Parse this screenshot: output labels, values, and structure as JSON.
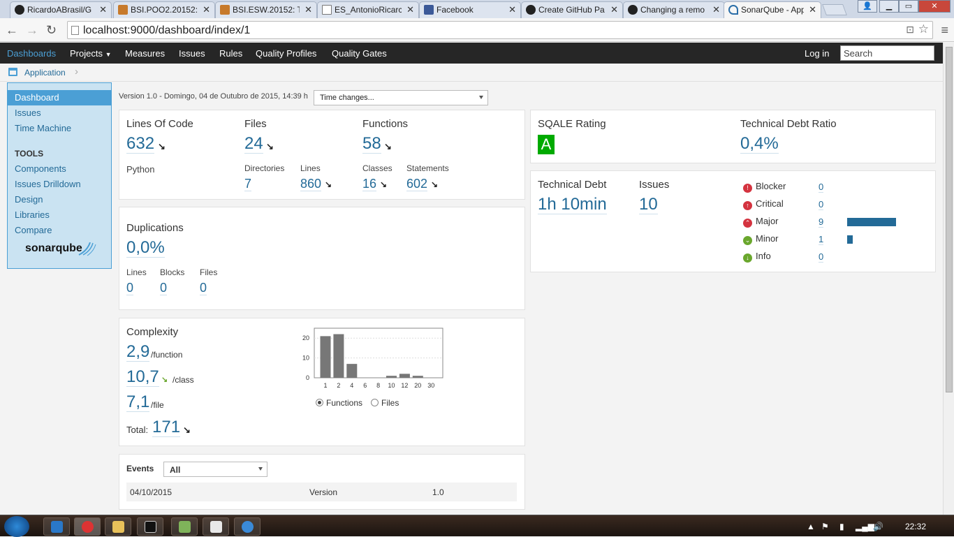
{
  "browser": {
    "tabs": [
      {
        "label": "RicardoABrasil/G",
        "icon": "github-icon"
      },
      {
        "label": "BSI.POO2.20152:",
        "icon": "moodle-icon"
      },
      {
        "label": "BSI.ESW.20152: T",
        "icon": "moodle-icon"
      },
      {
        "label": "ES_AntonioRicarc",
        "icon": "document-icon"
      },
      {
        "label": "Facebook",
        "icon": "facebook-icon"
      },
      {
        "label": "Create GitHub Pa",
        "icon": "github-icon"
      },
      {
        "label": "Changing a remo",
        "icon": "github-icon"
      },
      {
        "label": "SonarQube - App",
        "icon": "sonarqube-icon"
      }
    ],
    "url": "localhost:9000/dashboard/index/1"
  },
  "nav": {
    "dashboards": "Dashboards",
    "projects": "Projects",
    "measures": "Measures",
    "issues": "Issues",
    "rules": "Rules",
    "quality_profiles": "Quality Profiles",
    "quality_gates": "Quality Gates",
    "login": "Log in",
    "search_placeholder": "Search"
  },
  "breadcrumb": {
    "label": "Application"
  },
  "sidebar": {
    "dashboard": "Dashboard",
    "issues": "Issues",
    "time_machine": "Time Machine",
    "tools_heading": "TOOLS",
    "components": "Components",
    "issues_drilldown": "Issues Drilldown",
    "design": "Design",
    "libraries": "Libraries",
    "compare": "Compare",
    "logo": "sonarqube"
  },
  "header": {
    "version": "Version 1.0 - Domingo, 04 de Outubro de 2015, 14:39 h",
    "time_changes": "Time changes..."
  },
  "size": {
    "loc_label": "Lines Of Code",
    "loc": "632",
    "files_label": "Files",
    "files": "24",
    "functions_label": "Functions",
    "functions": "58",
    "language": "Python",
    "directories_label": "Directories",
    "directories": "7",
    "lines_label": "Lines",
    "lines": "860",
    "classes_label": "Classes",
    "classes": "16",
    "statements_label": "Statements",
    "statements": "602"
  },
  "duplications": {
    "title": "Duplications",
    "density": "0,0%",
    "lines_label": "Lines",
    "lines": "0",
    "blocks_label": "Blocks",
    "blocks": "0",
    "files_label": "Files",
    "files": "0"
  },
  "complexity": {
    "title": "Complexity",
    "per_function": "2,9",
    "per_function_unit": "/function",
    "per_class": "10,7",
    "per_class_unit": "/class",
    "per_file": "7,1",
    "per_file_unit": "/file",
    "total_label": "Total:",
    "total": "171",
    "radio_functions": "Functions",
    "radio_files": "Files"
  },
  "chart_data": {
    "type": "bar",
    "categories": [
      "1",
      "2",
      "4",
      "6",
      "8",
      "10",
      "12",
      "20",
      "30"
    ],
    "values": [
      21,
      22,
      7,
      0,
      0,
      1,
      2,
      1,
      0
    ],
    "yticks": [
      "0",
      "10",
      "20"
    ],
    "ylim": [
      0,
      25
    ],
    "title": "",
    "xlabel": "",
    "ylabel": "",
    "grid": true
  },
  "events": {
    "title": "Events",
    "filter": "All",
    "rows": [
      {
        "date": "04/10/2015",
        "type": "Version",
        "name": "1.0"
      }
    ]
  },
  "sqale": {
    "rating_label": "SQALE Rating",
    "rating": "A",
    "ratio_label": "Technical Debt Ratio",
    "ratio": "0,4%"
  },
  "issues": {
    "debt_label": "Technical Debt",
    "debt": "1h 10min",
    "issues_label": "Issues",
    "issues": "10",
    "severities": [
      {
        "name": "Blocker",
        "count": "0",
        "fraction": 0,
        "color": "#d4333f",
        "icon": "blocker-icon"
      },
      {
        "name": "Critical",
        "count": "0",
        "fraction": 0,
        "color": "#d4333f",
        "icon": "critical-icon"
      },
      {
        "name": "Major",
        "count": "9",
        "fraction": 1,
        "color": "#d4333f",
        "icon": "major-icon"
      },
      {
        "name": "Minor",
        "count": "1",
        "fraction": 0.11,
        "color": "#6aa72d",
        "icon": "minor-icon"
      },
      {
        "name": "Info",
        "count": "0",
        "fraction": 0,
        "color": "#6aa72d",
        "icon": "info-icon"
      }
    ]
  },
  "taskbar": {
    "clock": "22:32"
  }
}
